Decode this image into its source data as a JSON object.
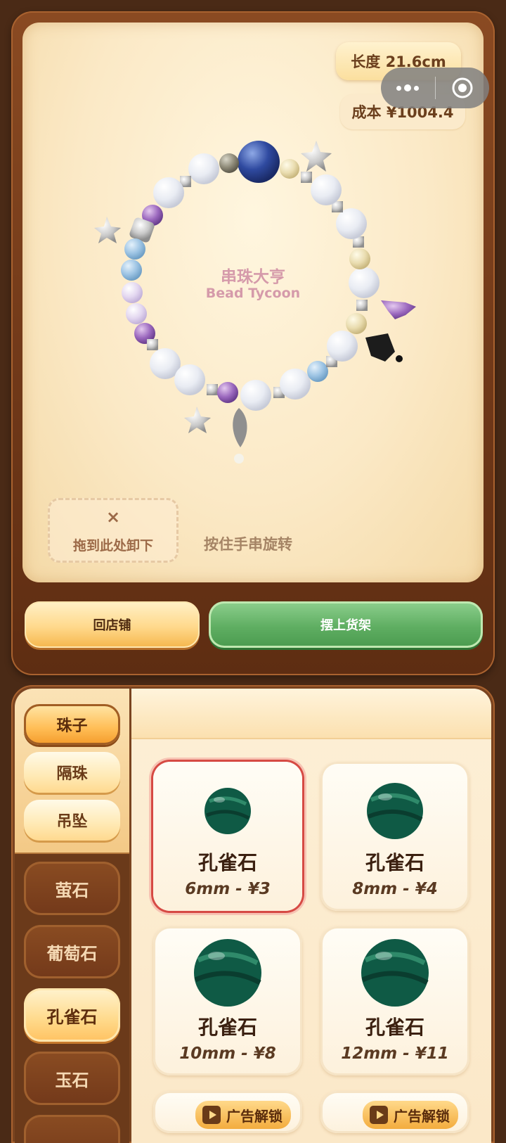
{
  "workspace": {
    "length_label": "长度 21.6cm",
    "cost_label": "成本 ¥1004.4",
    "brand_cn": "串珠大亨",
    "brand_en": "Bead Tycoon",
    "drop_zone_icon": "×",
    "drop_zone_label": "拖到此处卸下",
    "rotate_hint": "按住手串旋转"
  },
  "actions": {
    "back_to_shop": "回店铺",
    "put_on_shelf": "摆上货架"
  },
  "tabs": [
    {
      "label": "珠子",
      "active": true
    },
    {
      "label": "隔珠",
      "active": false
    },
    {
      "label": "吊坠",
      "active": false
    }
  ],
  "categories": [
    {
      "label": "萤石",
      "selected": false
    },
    {
      "label": "葡萄石",
      "selected": false
    },
    {
      "label": "孔雀石",
      "selected": true
    },
    {
      "label": "玉石",
      "selected": false
    }
  ],
  "products": [
    {
      "name": "孔雀石",
      "spec": "6mm - ¥3",
      "selected": true
    },
    {
      "name": "孔雀石",
      "spec": "8mm - ¥4",
      "selected": false
    },
    {
      "name": "孔雀石",
      "spec": "10mm - ¥8",
      "selected": false
    },
    {
      "name": "孔雀石",
      "spec": "12mm - ¥11",
      "selected": false
    }
  ],
  "locked_products": [
    {
      "badge": "广告解锁"
    },
    {
      "badge": "广告解锁"
    }
  ],
  "colors": {
    "accent_green": "#5fae62",
    "accent_orange": "#ffbd55",
    "selected_border": "#d64a44",
    "malachite": "#0f5a45"
  }
}
